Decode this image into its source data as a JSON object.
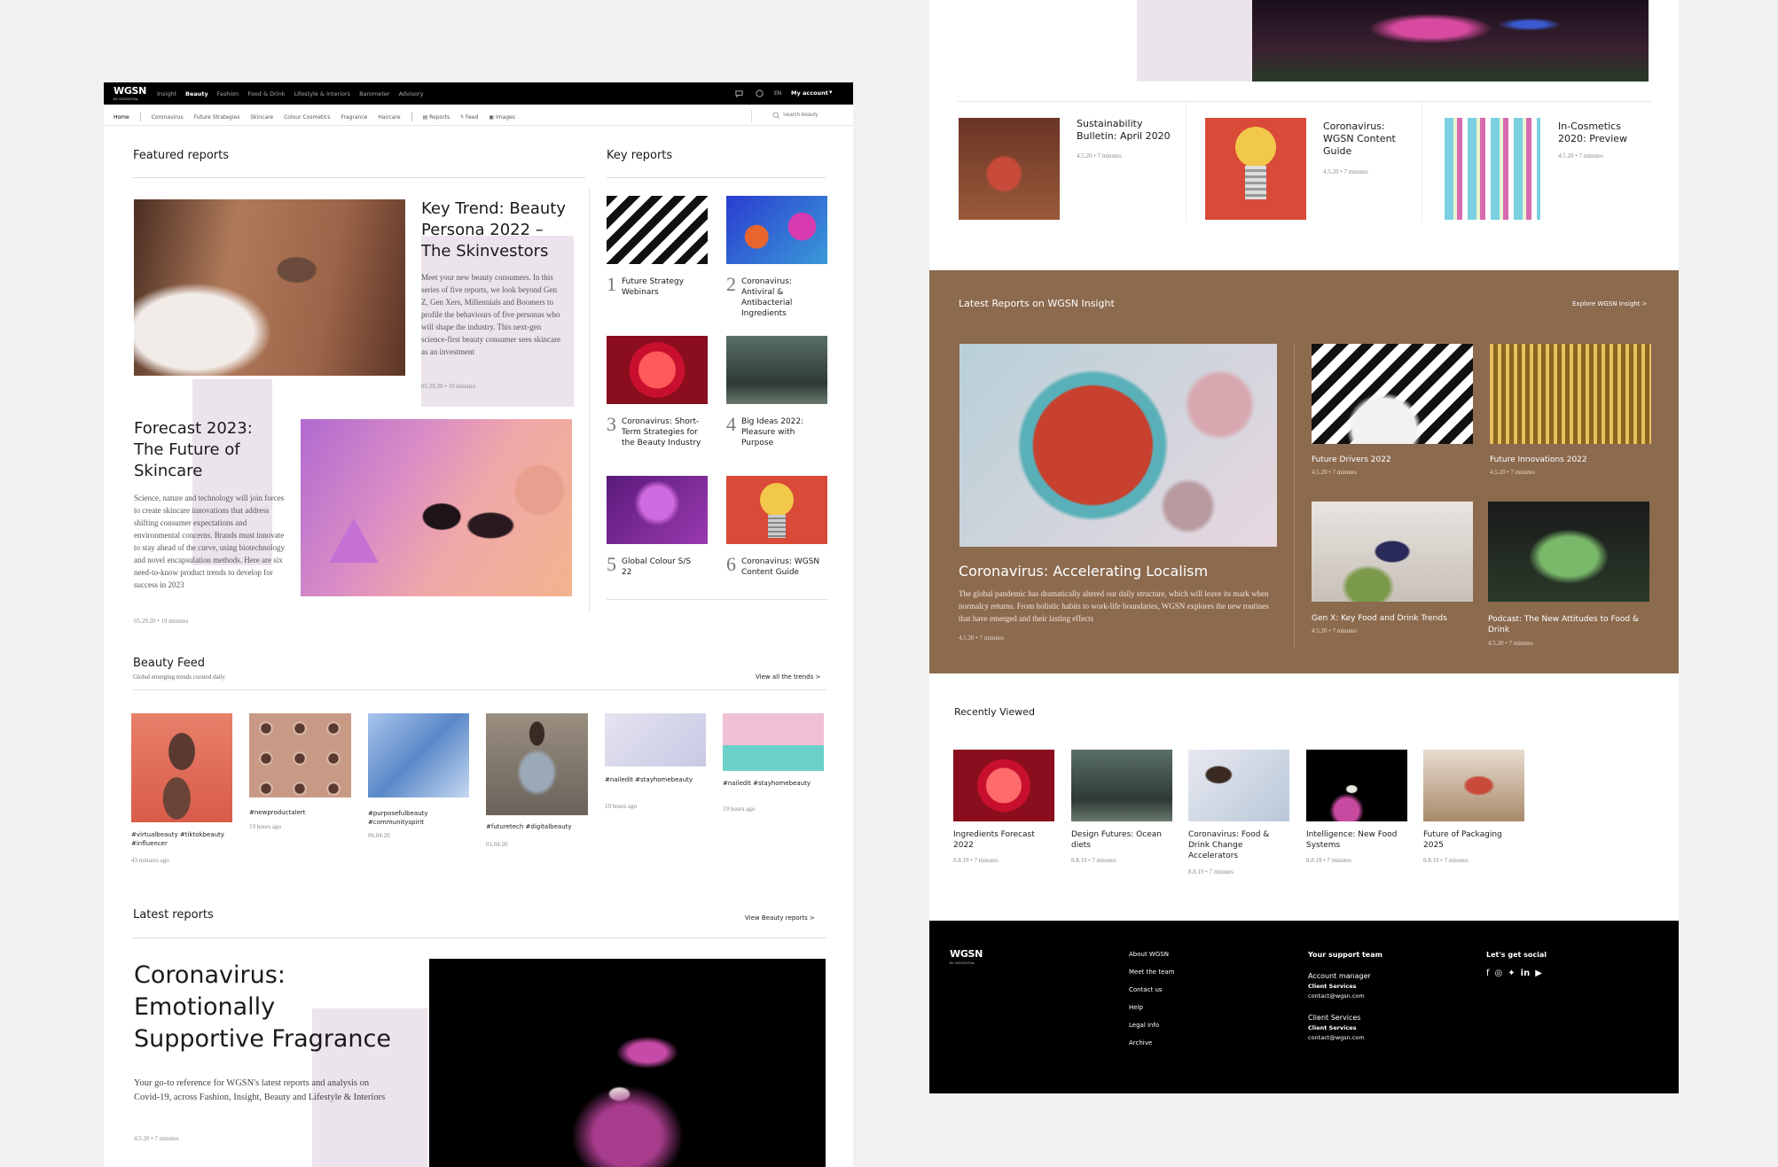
{
  "topnav": {
    "logo": "WGSN",
    "logo_sub": "BY ASCENTIAL",
    "items": [
      "Insight",
      "Beauty",
      "Fashion",
      "Food & Drink",
      "Lifestyle & Interiors",
      "Barometer",
      "Advisory"
    ],
    "lang": "EN",
    "account": "My account"
  },
  "subnav": {
    "items": [
      "Home",
      "Coronavirus",
      "Future Strategies",
      "Skincare",
      "Colour Cosmetics",
      "Fragrance",
      "Haircare"
    ],
    "tools": [
      "Reports",
      "Feed",
      "Images"
    ],
    "search_placeholder": "Search Beauty"
  },
  "featured": {
    "heading": "Featured reports",
    "r1": {
      "title": "Key Trend: Beauty Persona 2022 – The Skinvestors",
      "desc": "Meet your new beauty consumers. In this series of five reports, we look beyond Gen Z, Gen Xers, Millennials and Boomers to profile the behaviours of five personas who will shape the industry. This next-gen science-first beauty consumer sees skincare as an investment",
      "meta": "05.29.20 • 19 minutes"
    },
    "r2": {
      "title": "Forecast 2023: The Future of Skincare",
      "desc": "Science, nature and technology will join forces to create skincare innovations that address shifting consumer expectations and environmental concerns. Brands must innovate to stay ahead of the curve, using biotechnology and novel encapsulation methods. Here are six need-to-know product trends to develop for success in 2023",
      "meta": "05.29.20 • 19 minutes"
    }
  },
  "key_reports": {
    "heading": "Key reports",
    "items": [
      {
        "num": "1",
        "title": "Future Strategy Webinars"
      },
      {
        "num": "2",
        "title": "Coronavirus: Antiviral & Antibacterial Ingredients"
      },
      {
        "num": "3",
        "title": "Coronavirus: Short-Term Strategies for the Beauty Industry"
      },
      {
        "num": "4",
        "title": "Big Ideas 2022: Pleasure with Purpose"
      },
      {
        "num": "5",
        "title": "Global Colour S/S 22"
      },
      {
        "num": "6",
        "title": "Coronavirus: WGSN Content Guide"
      }
    ]
  },
  "feed": {
    "heading": "Beauty Feed",
    "sub": "Global emerging trends curated daily",
    "link": "View all the trends >",
    "items": [
      {
        "tags": "#virtualbeauty #tiktokbeauty #influencer",
        "time": "43 minutes ago"
      },
      {
        "tags": "#newproductalert",
        "time": "19 hours ago"
      },
      {
        "tags": "#purposefulbeauty #communityspirit",
        "time": "06.04.20"
      },
      {
        "tags": "#futuretech #digitalbeauty",
        "time": "01.04.20"
      },
      {
        "tags": "#nailedit #stayhomebeauty",
        "time": "19 hours ago"
      },
      {
        "tags": "#nailedit #stayhomebeauty",
        "time": "19 hours ago"
      }
    ]
  },
  "latest": {
    "heading": "Latest reports",
    "link": "View Beauty reports >",
    "title": "Coronavirus: Emotionally Supportive Fragrance",
    "desc": "Your go-to reference for WGSN's latest reports and analysis on Covid-19, across Fashion, Insight, Beauty and Lifestyle & Interiors",
    "meta": "4.5.20 • 7 minutes"
  },
  "right_top": {
    "items": [
      {
        "title": "Sustainability Bulletin: April 2020",
        "meta": "4.5.20 • 7 minutes"
      },
      {
        "title": "Coronavirus: WGSN Content Guide",
        "meta": "4.5.20 • 7 minutes"
      },
      {
        "title": "In-Cosmetics 2020: Preview",
        "meta": "4.5.20 • 7 minutes"
      }
    ]
  },
  "insight": {
    "heading": "Latest Reports on WGSN Insight",
    "link": "Explore WGSN Insight >",
    "main_title": "Coronavirus: Accelerating Localism",
    "main_desc": "The global pandemic has dramatically altered our daily structure, which will leave its mark when normalcy returns. From holistic habits to work-life boundaries, WGSN explores the new routines that have emerged and their lasting effects",
    "main_meta": "4.5.20 • 7 minutes",
    "cards": [
      {
        "title": "Future Drivers 2022",
        "meta": "4.5.20 • 7 minutes"
      },
      {
        "title": "Future Innovations 2022",
        "meta": "4.5.20 • 7 minutes"
      },
      {
        "title": "Gen X: Key Food and Drink Trends",
        "meta": "4.5.20 • 7 minutes"
      },
      {
        "title": "Podcast: The New Attitudes to Food & Drink",
        "meta": "4.5.20 • 7 minutes"
      }
    ],
    "bg": "#8c6a4e"
  },
  "recent": {
    "heading": "Recently Viewed",
    "items": [
      {
        "title": "Ingredients Forecast 2022",
        "meta": "8.8.19 • 7 minutes"
      },
      {
        "title": "Design Futures: Ocean diets",
        "meta": "8.8.19 • 7 minutes"
      },
      {
        "title": "Coronavirus: Food & Drink Change Accelerators",
        "meta": "8.8.19 • 7 minutes"
      },
      {
        "title": "Intelligence: New Food Systems",
        "meta": "8.8.19 • 7 minutes"
      },
      {
        "title": "Future of Packaging 2025",
        "meta": "8.8.19 • 7 minutes"
      }
    ]
  },
  "footer": {
    "logo": "WGSN",
    "logo_sub": "BY ASCENTIAL",
    "links": [
      "About WGSN",
      "Meet the team",
      "Contact us",
      "Help",
      "Legal info",
      "Archive"
    ],
    "support_heading": "Your support team",
    "support": [
      {
        "role": "Account manager",
        "name": "Client Services",
        "email": "contact@wgsn.com"
      },
      {
        "role": "Client Services",
        "name": "Client Services",
        "email": "contact@wgsn.com"
      }
    ],
    "social_heading": "Let's get social",
    "social_icons": [
      "facebook-icon",
      "instagram-icon",
      "twitter-icon",
      "linkedin-icon",
      "youtube-icon"
    ]
  }
}
